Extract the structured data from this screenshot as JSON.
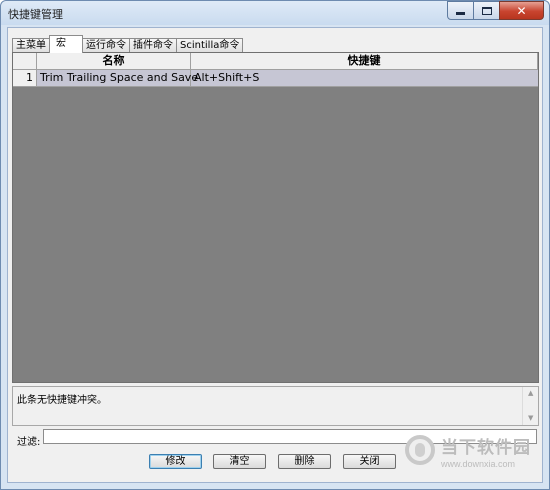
{
  "window": {
    "title": "快捷键管理"
  },
  "tabs": [
    "主菜单",
    "宏",
    "运行命令",
    "插件命令",
    "Scintilla命令"
  ],
  "active_tab_index": 1,
  "table": {
    "columns": [
      "名称",
      "快捷键"
    ],
    "rows": [
      {
        "index": "1",
        "name": "Trim Trailing Space and Save",
        "shortcut": "Alt+Shift+S"
      }
    ]
  },
  "status_message": "此条无快捷键冲突。",
  "filter": {
    "label": "过滤:",
    "value": ""
  },
  "buttons": {
    "modify": "修改",
    "clear": "清空",
    "delete": "删除",
    "close": "关闭"
  },
  "watermark": {
    "name": "当下软件园",
    "url": "www.downxia.com"
  },
  "colors": {
    "grid_background": "#808080",
    "selected_row": "#c6c6d4",
    "close_button": "#c8442f"
  }
}
